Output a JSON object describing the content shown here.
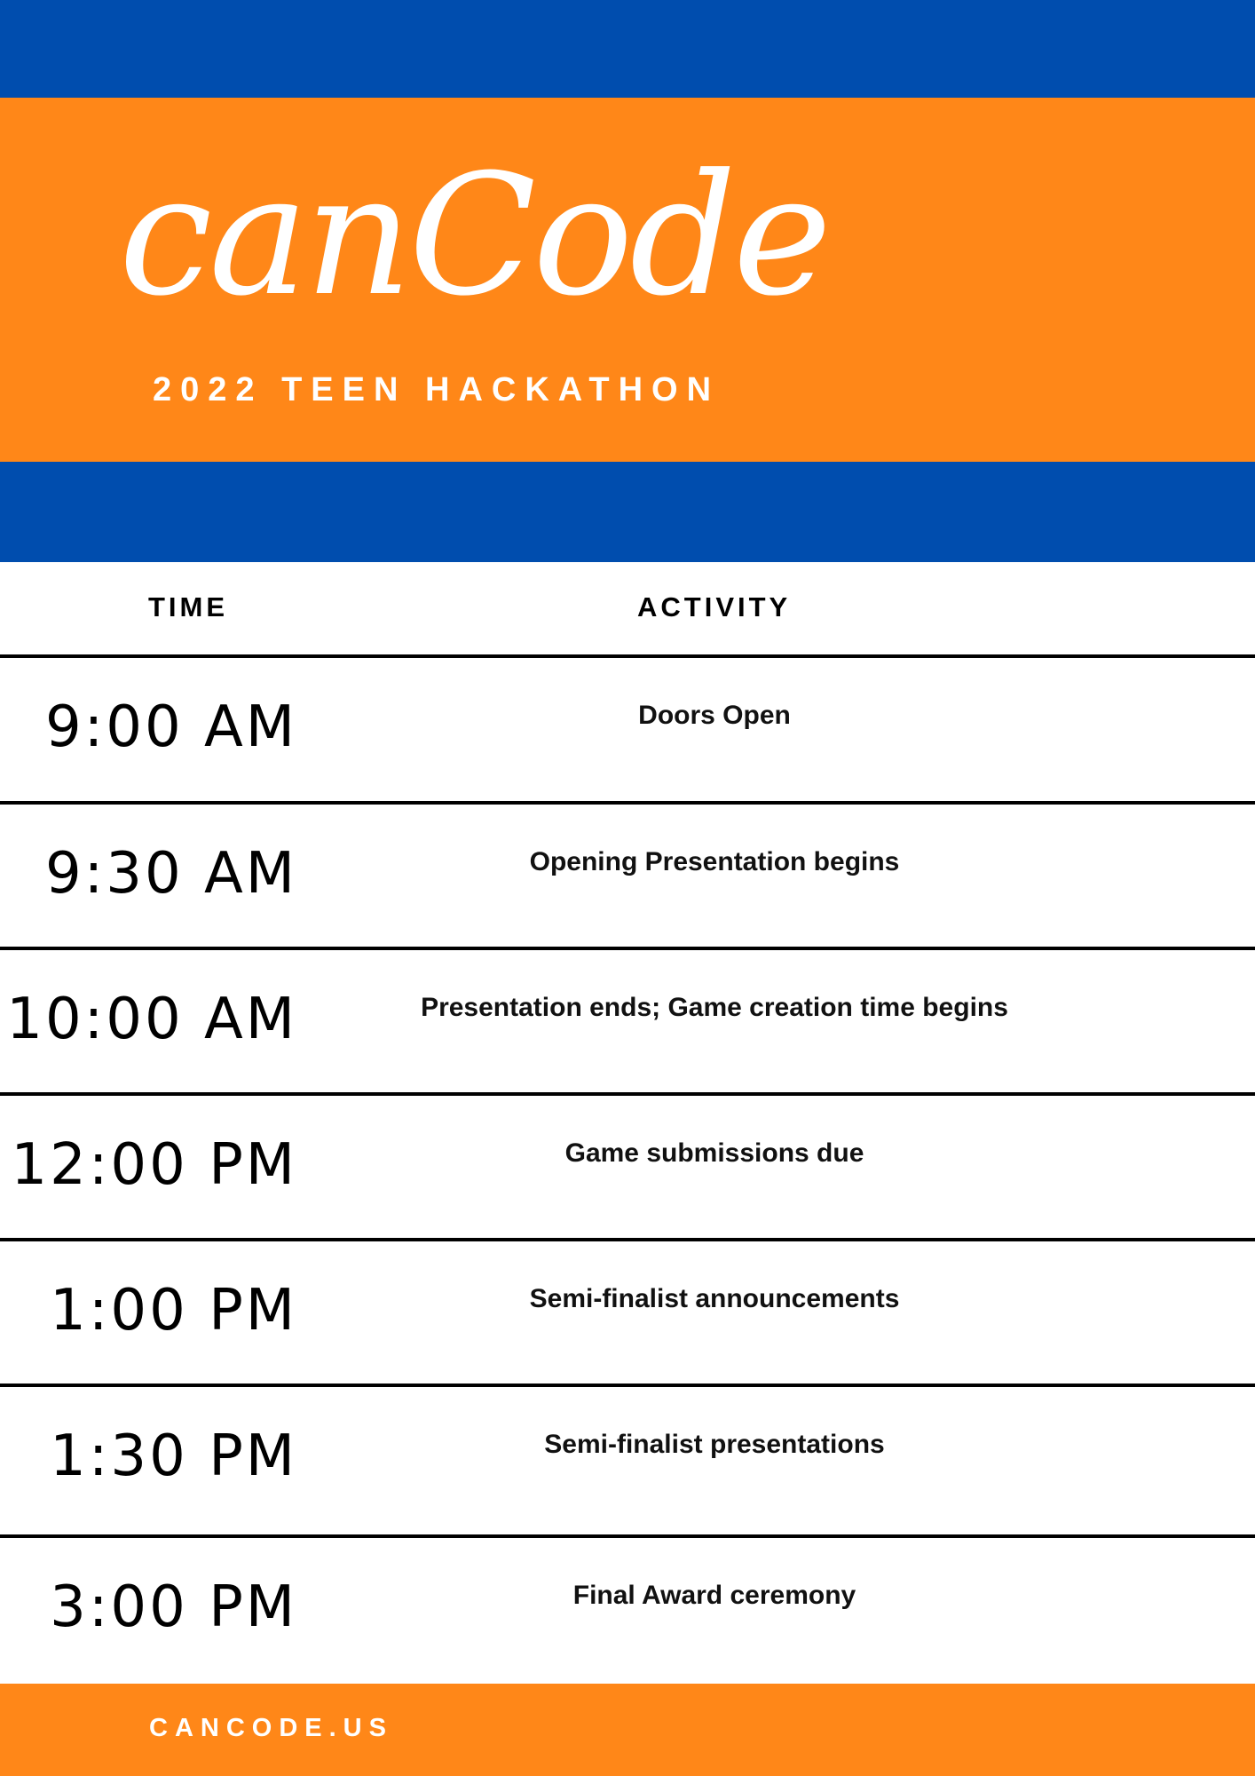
{
  "header": {
    "title": "canCode",
    "subtitle": "2022 TEEN HACKATHON",
    "colors": {
      "primary_blue": "#004DAE",
      "accent_orange": "#FF8718",
      "text_on_color": "#FFFFFF"
    }
  },
  "schedule": {
    "columns": {
      "time": "TIME",
      "activity": "ACTIVITY"
    },
    "rows": [
      {
        "time": "9:00 AM",
        "activity": "Doors Open"
      },
      {
        "time": "9:30 AM",
        "activity": "Opening Presentation begins"
      },
      {
        "time": "10:00 AM",
        "activity": "Presentation ends; Game creation time begins"
      },
      {
        "time": "12:00 PM",
        "activity": "Game submissions due"
      },
      {
        "time": "1:00 PM",
        "activity": "Semi-finalist announcements"
      },
      {
        "time": "1:30 PM",
        "activity": "Semi-finalist presentations"
      },
      {
        "time": "3:00 PM",
        "activity": "Final Award ceremony"
      }
    ]
  },
  "footer": {
    "link_text": "CANCODE.US"
  }
}
